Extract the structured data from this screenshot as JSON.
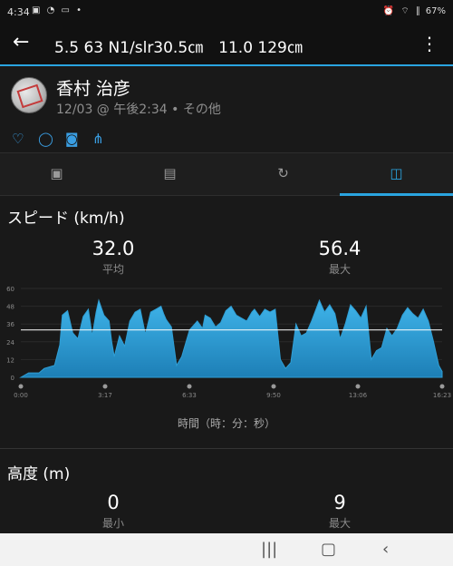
{
  "status_bar": {
    "time": "4:34",
    "battery": "67%"
  },
  "app_bar": {
    "title": "5.5 63 N1/slr30.5㎝　11.0 129㎝"
  },
  "profile": {
    "name": "香村 治彦",
    "meta": "12/03 @ 午後2:34 • その他"
  },
  "speed": {
    "title": "スピード (km/h)",
    "avg_value": "32.0",
    "avg_label": "平均",
    "max_value": "56.4",
    "max_label": "最大",
    "x_axis_title": "時間（時：分：秒）"
  },
  "elevation": {
    "title": "高度 (m)",
    "min_value": "0",
    "min_label": "最小",
    "max_value": "9",
    "max_label": "最大"
  },
  "chart_data": {
    "type": "area",
    "x_ticks": [
      "0:00",
      "3:17",
      "6:33",
      "9:50",
      "13:06",
      "16:23"
    ],
    "y_ticks": [
      "0",
      "12",
      "24",
      "36",
      "48",
      "60"
    ],
    "ylim": [
      0,
      60
    ],
    "reference_line": 32.0,
    "x": [
      0,
      0.3,
      0.7,
      0.9,
      1.3,
      1.5,
      1.6,
      1.8,
      2.0,
      2.2,
      2.4,
      2.6,
      2.75,
      2.9,
      3.0,
      3.2,
      3.4,
      3.5,
      3.6,
      3.8,
      4.0,
      4.2,
      4.4,
      4.6,
      4.8,
      5.0,
      5.2,
      5.4,
      5.5,
      5.6,
      5.8,
      6.0,
      6.2,
      6.5,
      6.8,
      7.0,
      7.1,
      7.3,
      7.5,
      7.7,
      7.9,
      8.1,
      8.3,
      8.5,
      8.7,
      8.9,
      9.0,
      9.2,
      9.4,
      9.6,
      9.8,
      10.0,
      10.2,
      10.4,
      10.6,
      10.8,
      11.0,
      11.2,
      11.5,
      11.7,
      11.9,
      12.1,
      12.3,
      12.5,
      12.7,
      12.9,
      13.1,
      13.3,
      13.5,
      13.7,
      13.9,
      14.1,
      14.3,
      14.5,
      14.7,
      14.9,
      15.1,
      15.3,
      15.5,
      15.7,
      15.9,
      16.1,
      16.23
    ],
    "y": [
      0,
      3,
      3,
      6,
      8,
      22,
      42,
      45,
      30,
      26,
      41,
      46,
      28,
      44,
      52,
      42,
      38,
      24,
      14,
      28,
      21,
      38,
      44,
      46,
      29,
      44,
      46,
      48,
      43,
      39,
      34,
      8,
      14,
      32,
      38,
      33,
      42,
      40,
      34,
      37,
      45,
      48,
      42,
      40,
      38,
      44,
      46,
      41,
      46,
      44,
      46,
      12,
      6,
      10,
      36,
      28,
      30,
      38,
      52,
      44,
      49,
      43,
      26,
      36,
      49,
      45,
      40,
      48,
      12,
      18,
      20,
      33,
      28,
      33,
      42,
      47,
      43,
      40,
      46,
      38,
      24,
      8,
      4
    ],
    "xlabel": "時間（時：分：秒）",
    "ylabel": "スピード (km/h)",
    "color": "#2f9fd6"
  }
}
